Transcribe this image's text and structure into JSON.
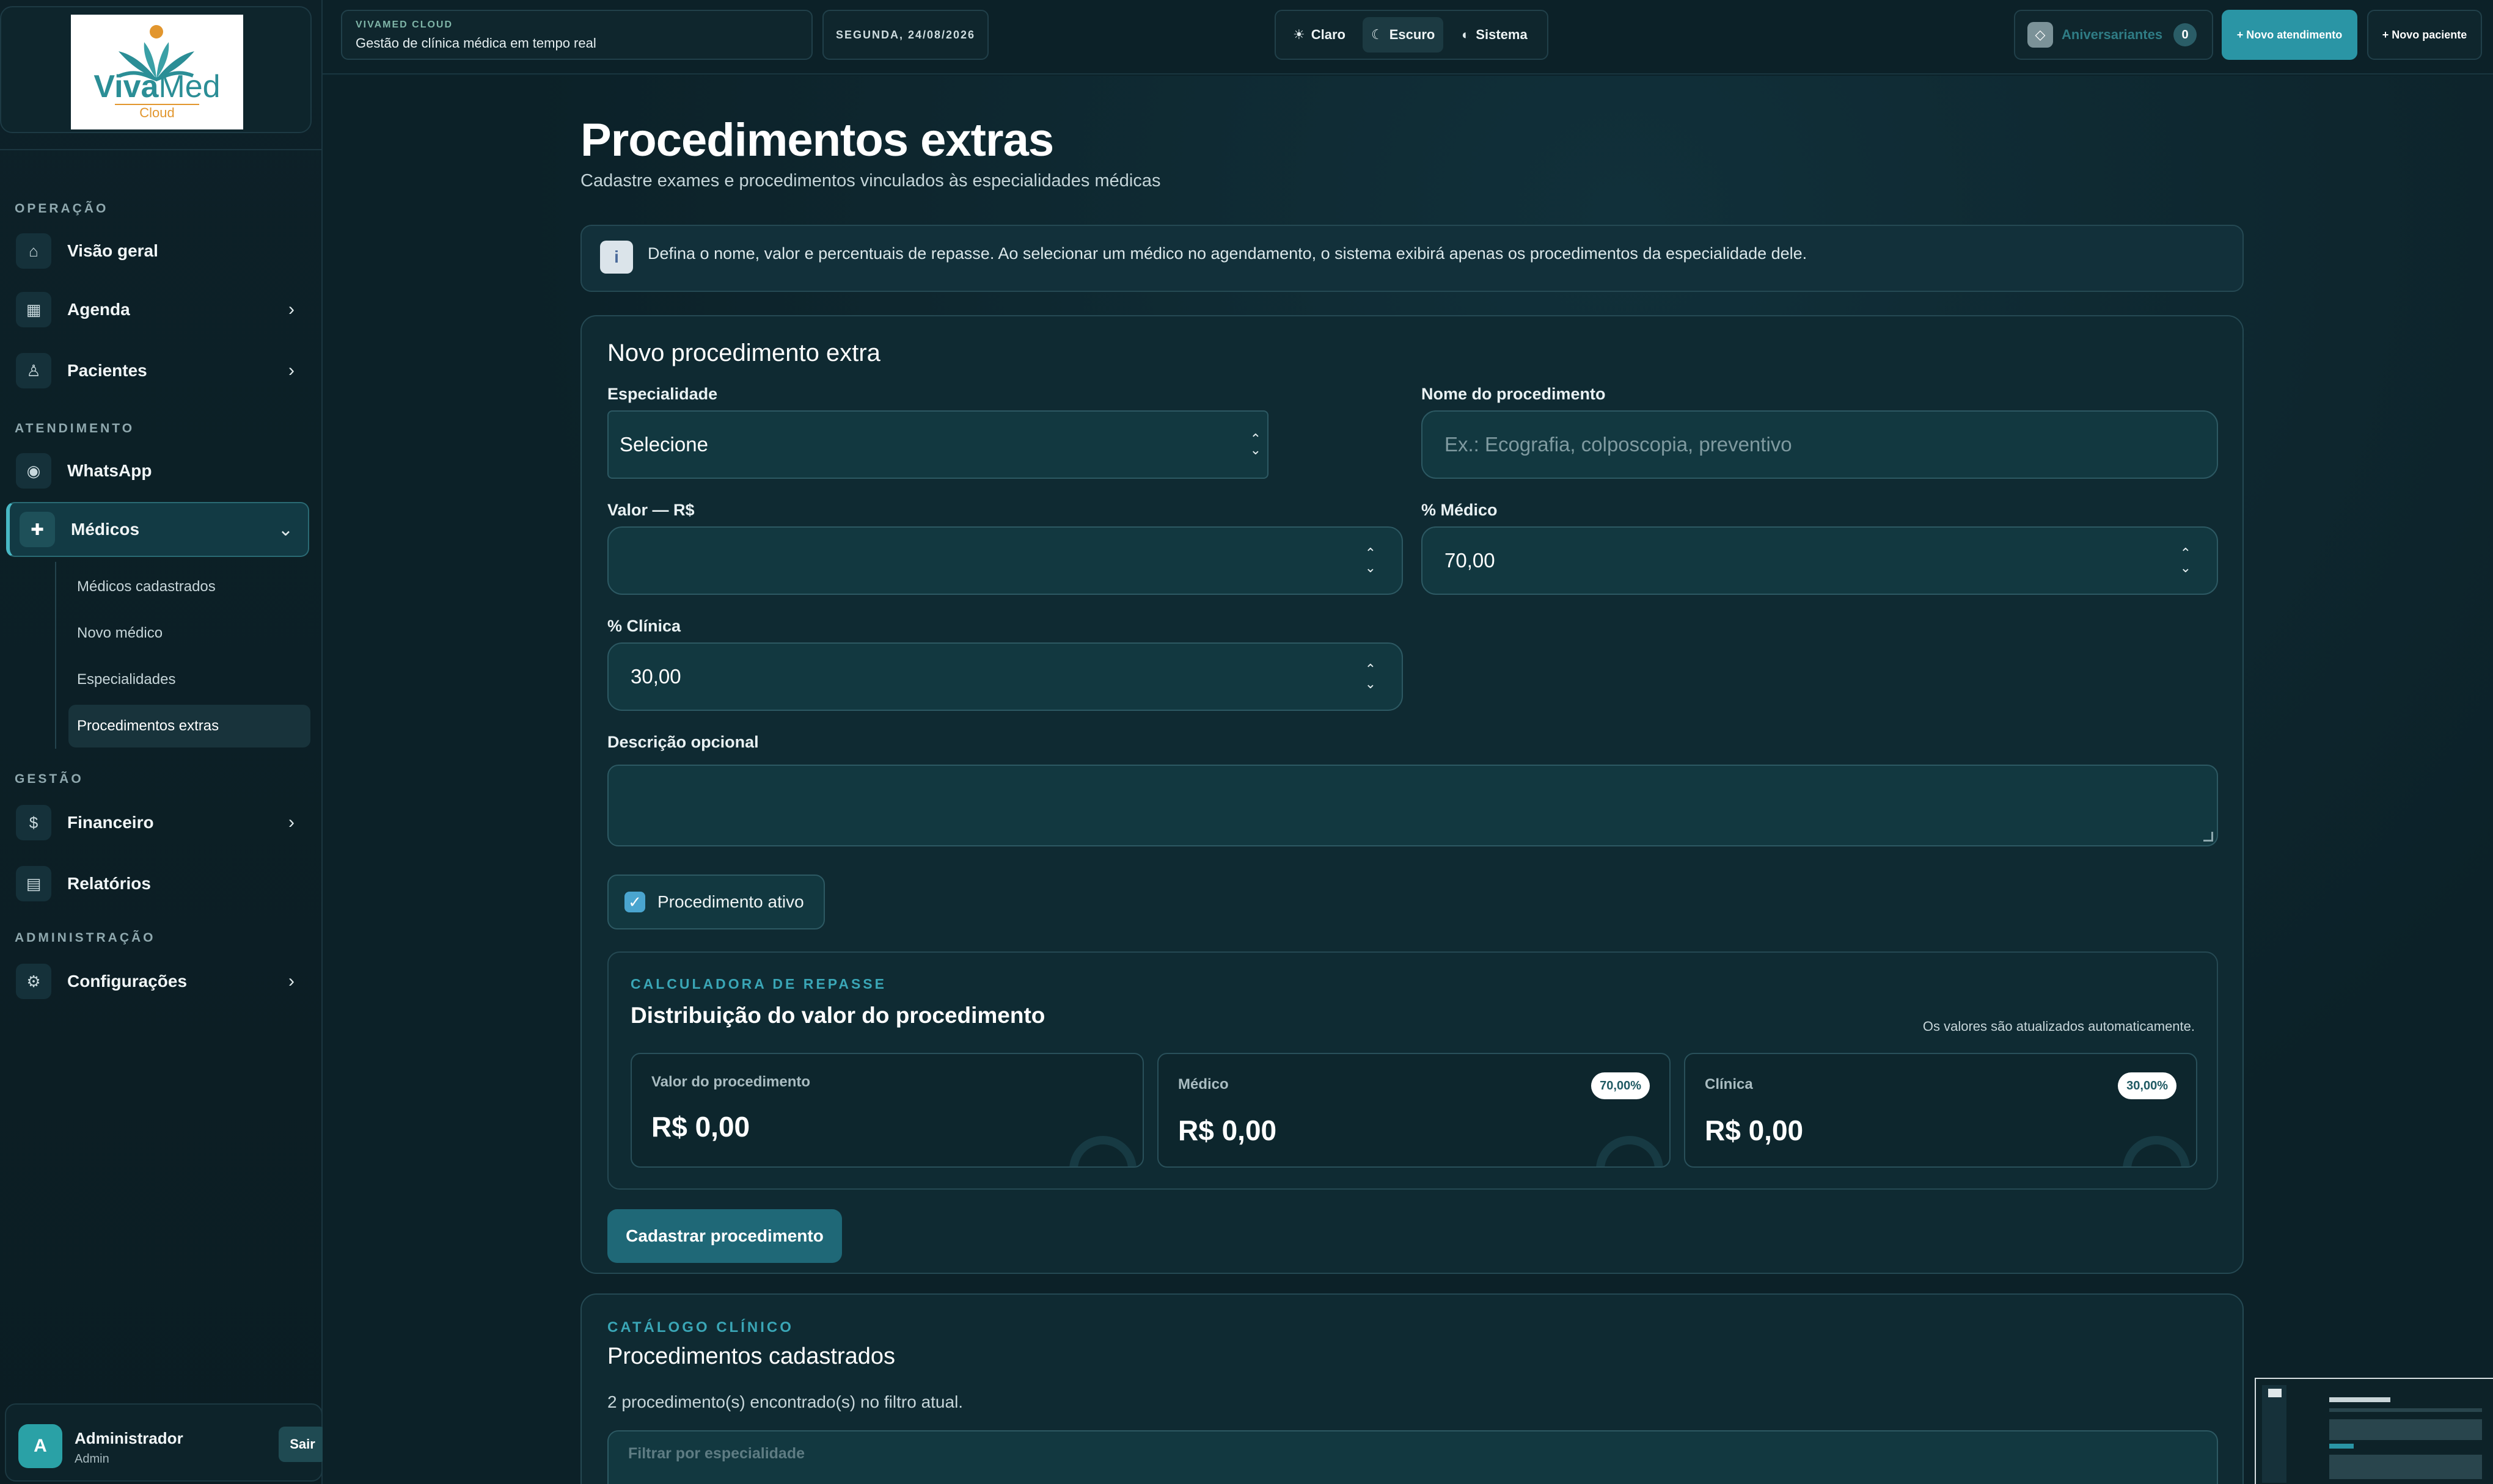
{
  "sidebar": {
    "logo": {
      "name_bold": "Viva",
      "name_rest": "Med",
      "sub": "Cloud"
    },
    "sections": {
      "operacao": "OPERAÇÃO",
      "atendimento": "ATENDIMENTO",
      "gestao": "GESTÃO",
      "administracao": "ADMINISTRAÇÃO"
    },
    "items": {
      "visao_geral": "Visão geral",
      "agenda": "Agenda",
      "pacientes": "Pacientes",
      "whatsapp": "WhatsApp",
      "medicos": "Médicos",
      "financeiro": "Financeiro",
      "relatorios": "Relatórios",
      "configuracoes": "Configurações"
    },
    "medicos_sub": [
      "Médicos cadastrados",
      "Novo médico",
      "Especialidades",
      "Procedimentos extras"
    ],
    "icons": {
      "visao_geral": "home-icon",
      "agenda": "calendar-icon",
      "pacientes": "patients-icon",
      "whatsapp": "whatsapp-icon",
      "medicos": "plus-medical-icon",
      "financeiro": "dollar-icon",
      "relatorios": "report-icon",
      "configuracoes": "gear-icon"
    },
    "user": {
      "initial": "A",
      "name": "Administrador",
      "role": "Admin",
      "logout": "Sair"
    }
  },
  "topbar": {
    "brand_kicker": "VIVAMED CLOUD",
    "brand_title": "Gestão de clínica médica em tempo real",
    "date": "SEGUNDA, 24/08/2026",
    "themes": {
      "light": "Claro",
      "dark": "Escuro",
      "system": "Sistema"
    },
    "active_theme": "dark",
    "birthdays_label": "Aniversariantes",
    "birthdays_count": "0",
    "new_appointment": "+ Novo atendimento",
    "new_patient": "+ Novo paciente"
  },
  "page": {
    "title": "Procedimentos extras",
    "subtitle": "Cadastre exames e procedimentos vinculados às especialidades médicas",
    "info": "Defina o nome, valor e percentuais de repasse. Ao selecionar um médico no agendamento, o sistema exibirá apenas os procedimentos da especialidade dele."
  },
  "form": {
    "title": "Novo procedimento extra",
    "especialidade_label": "Especialidade",
    "especialidade_value": "Selecione",
    "nome_label": "Nome do procedimento",
    "nome_placeholder": "Ex.: Ecografia, colposcopia, preventivo",
    "valor_label": "Valor — R$",
    "valor_value": "",
    "medico_label": "% Médico",
    "medico_value": "70,00",
    "clinica_label": "% Clínica",
    "clinica_value": "30,00",
    "descricao_label": "Descrição opcional",
    "ativo_label": "Procedimento ativo",
    "ativo_checked": true,
    "submit": "Cadastrar procedimento"
  },
  "calculator": {
    "kicker": "CALCULADORA DE REPASSE",
    "title": "Distribuição do valor do procedimento",
    "note": "Os valores são atualizados automaticamente.",
    "cards": {
      "valor_label": "Valor do procedimento",
      "valor_value": "R$ 0,00",
      "medico_label": "Médico",
      "medico_value": "R$ 0,00",
      "medico_pct": "70,00%",
      "clinica_label": "Clínica",
      "clinica_value": "R$ 0,00",
      "clinica_pct": "30,00%"
    }
  },
  "catalog": {
    "kicker": "CATÁLOGO CLÍNICO",
    "title": "Procedimentos cadastrados",
    "count_text": "2 procedimento(s) encontrado(s) no filtro atual.",
    "filter_label": "Filtrar por especialidade"
  },
  "colors": {
    "accent": "#2a95a5",
    "background": "#0c2229",
    "logo_teal": "#2b8e96",
    "logo_orange": "#e2962e"
  }
}
